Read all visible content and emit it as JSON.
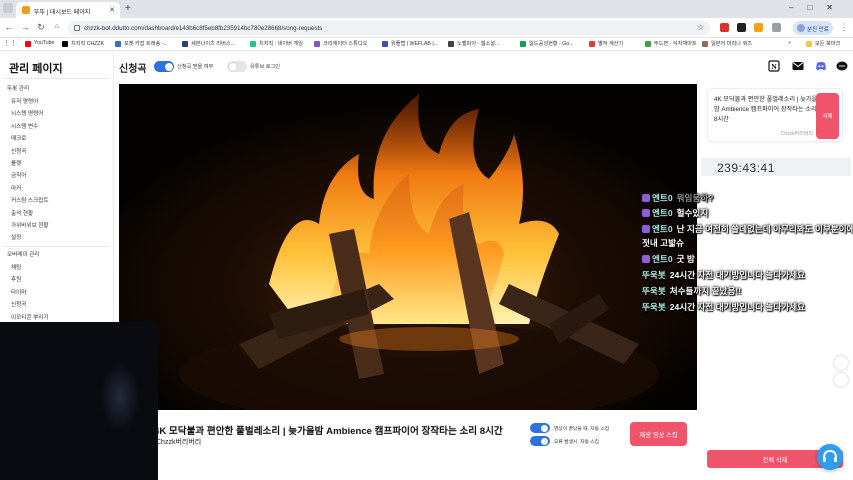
{
  "browser": {
    "tab_title": "뚜뚜 | 대시보드 페이지",
    "url": "chzzk-bot.ddutto.com/dashboard/e143b6c8f5eb8fb235914bc780e28668/song-requests",
    "profile_label": "분진 만료",
    "bookmarks_more": "»",
    "bookmarks_all": "모든 북마크",
    "bookmarks": [
      {
        "label": "YouTube",
        "color": "#ff0000"
      },
      {
        "label": "치지직 CHZZK",
        "color": "#000000"
      },
      {
        "label": "포켓 카잡 트래송 -...",
        "color": "#3b6cc9"
      },
      {
        "label": "세븐나이츠 리버스...",
        "color": "#2e3f7a"
      },
      {
        "label": "치지직 : 네이버 게임",
        "color": "#1dc78a"
      },
      {
        "label": "크리에이터 스튜디오",
        "color": "#7e57c2"
      },
      {
        "label": "위플랩 | WEFLAB |...",
        "color": "#3f51b5"
      },
      {
        "label": "노벨피아 - 웹소설...",
        "color": "#444444"
      },
      {
        "label": "일드공성현황 - Go...",
        "color": "#0f9d58"
      },
      {
        "label": "별작 계산기",
        "color": "#e53935"
      },
      {
        "label": "뚜드면 - 식자재마트",
        "color": "#43a047"
      },
      {
        "label": "일본어 마리나 퀴즈",
        "color": "#8d6e63"
      }
    ]
  },
  "sidebar": {
    "title": "관리 페이지",
    "section1": "뚜봇 관리",
    "items1": [
      "유저 명령어",
      "시스템 명령어",
      "시스템 변수",
      "매크로",
      "신청곡",
      "룰렛",
      "금칙어",
      "마커",
      "커스텀 스크립트",
      "출석 현황",
      "가위바위보 현황",
      "설정"
    ],
    "section2": "오버레이 관리",
    "items2": [
      "채팅",
      "후원",
      "타이머",
      "신청곡",
      "이모티콘 뿌리기"
    ]
  },
  "topbar": {
    "title": "신청곡",
    "toggle1_label": "신청곡 받을 여부",
    "toggle1_on": true,
    "toggle2_label": "유튜브 로그인",
    "toggle2_on": false,
    "icons": [
      "notion-icon",
      "mail-icon",
      "discord-icon",
      "chat-bubble-icon"
    ]
  },
  "queue": [
    {
      "title": "4K 모닥불과 편안한 풀벌레소리 | 늦가을밤 Ambience 캠프파이어 장작타는 소리 8시간",
      "requester": "Chzzk버리버리",
      "delete_label": "삭제"
    }
  ],
  "timer": "239:43:41",
  "chat": [
    {
      "nick": "엔트0",
      "msg": "뭐임웅하?",
      "badge": true,
      "ghost": true
    },
    {
      "nick": "엔트0",
      "msg": "헐수있지",
      "badge": true,
      "ghost": false
    },
    {
      "nick": "엔트0",
      "msg": "난 지금 여전히 쓸데없는데 아무리봐도 이부분이에 에",
      "badge": true,
      "ghost": false
    },
    {
      "nick": "",
      "msg": "젓내 고밟슈",
      "badge": false,
      "ghost": false
    },
    {
      "nick": "엔트0",
      "msg": "굿 밤",
      "badge": true,
      "ghost": false
    },
    {
      "nick": "뚜욱봇",
      "msg": "24시간 자전 대기방입니다 놀다가세요",
      "badge": false,
      "ghost": false
    },
    {
      "nick": "뚜욱봇",
      "msg": "처수들까지 끝났음!!",
      "badge": false,
      "ghost": false
    },
    {
      "nick": "뚜욱봇",
      "msg": "24시간 자전 대기방입니다 놀다가세요",
      "badge": false,
      "ghost": false
    }
  ],
  "now_playing": {
    "title": "4K 모닥불과 편안한 풀벌레소리 | 늦가을밤 Ambience 캠프파이어 장작타는 소리 8시간",
    "requester": "Chzzk버리버리",
    "opt1_label": "영상이 끝났을 때, 자동 스킵",
    "opt2_label": "오류 발생시, 자동 스킵",
    "skip_label": "재생 영상 스킵"
  },
  "delete_all_label": "전체 삭제",
  "colors": {
    "accent_blue": "#2f6fde",
    "danger_red": "#f0546a",
    "chat_nick": "#aee8e4"
  }
}
